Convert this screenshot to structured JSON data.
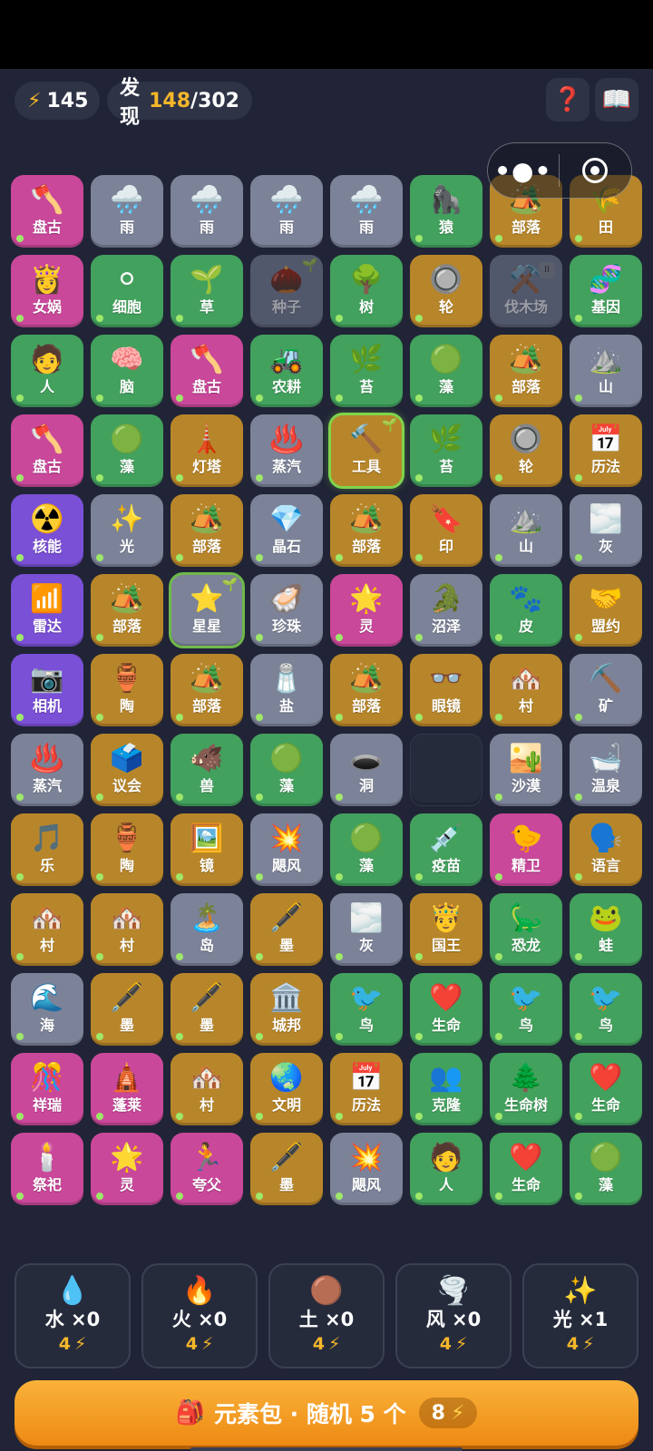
{
  "header": {
    "energy": "145",
    "discover_label": "发现",
    "discover_found": "148",
    "discover_total": "/302",
    "help_icon": "❓",
    "book_icon": "📖"
  },
  "capsule": {
    "more": "•●•"
  },
  "tiles": [
    {
      "e": "🪓",
      "l": "盘古",
      "c": "pink",
      "dot": true
    },
    {
      "e": "🌧️",
      "l": "雨",
      "c": "gray"
    },
    {
      "e": "🌧️",
      "l": "雨",
      "c": "gray"
    },
    {
      "e": "🌧️",
      "l": "雨",
      "c": "gray"
    },
    {
      "e": "🌧️",
      "l": "雨",
      "c": "gray"
    },
    {
      "e": "🦍",
      "l": "猿",
      "c": "green",
      "dot": true
    },
    {
      "e": "🏕️",
      "l": "部落",
      "c": "gold",
      "dot": true
    },
    {
      "e": "🌾",
      "l": "田",
      "c": "gold",
      "dot": true
    },
    {
      "e": "👸",
      "l": "女娲",
      "c": "pink",
      "dot": true
    },
    {
      "e": "⚪",
      "l": "细胞",
      "c": "green",
      "dot": true
    },
    {
      "e": "🌱",
      "l": "草",
      "c": "green",
      "dot": true
    },
    {
      "e": "🌰",
      "l": "种子",
      "c": "gray",
      "fade": true,
      "sprout": true
    },
    {
      "e": "🌳",
      "l": "树",
      "c": "green",
      "dot": true
    },
    {
      "e": "🔘",
      "l": "轮",
      "c": "gold",
      "dot": true
    },
    {
      "e": "⚒️",
      "l": "伐木场",
      "c": "gray",
      "fade": true,
      "pause": true
    },
    {
      "e": "🧬",
      "l": "基因",
      "c": "green",
      "dot": true
    },
    {
      "e": "🧑",
      "l": "人",
      "c": "green",
      "dot": true
    },
    {
      "e": "🧠",
      "l": "脑",
      "c": "green",
      "dot": true
    },
    {
      "e": "🪓",
      "l": "盘古",
      "c": "pink",
      "dot": true
    },
    {
      "e": "🚜",
      "l": "农耕",
      "c": "green",
      "dot": true
    },
    {
      "e": "🌿",
      "l": "苔",
      "c": "green",
      "dot": true
    },
    {
      "e": "🟢",
      "l": "藻",
      "c": "green",
      "dot": true
    },
    {
      "e": "🏕️",
      "l": "部落",
      "c": "gold",
      "dot": true
    },
    {
      "e": "⛰️",
      "l": "山",
      "c": "gray",
      "dot": true
    },
    {
      "e": "🪓",
      "l": "盘古",
      "c": "pink",
      "dot": true
    },
    {
      "e": "🟢",
      "l": "藻",
      "c": "green",
      "dot": true
    },
    {
      "e": "🗼",
      "l": "灯塔",
      "c": "gold",
      "dot": true
    },
    {
      "e": "♨️",
      "l": "蒸汽",
      "c": "gray",
      "dot": true
    },
    {
      "e": "🔨",
      "l": "工具",
      "c": "gold",
      "hl": true,
      "sprout": true
    },
    {
      "e": "🌿",
      "l": "苔",
      "c": "green",
      "dot": true
    },
    {
      "e": "🔘",
      "l": "轮",
      "c": "gold",
      "dot": true
    },
    {
      "e": "📅",
      "l": "历法",
      "c": "gold",
      "dot": true
    },
    {
      "e": "☢️",
      "l": "核能",
      "c": "purple",
      "dot": true
    },
    {
      "e": "✨",
      "l": "光",
      "c": "gray",
      "dot": true
    },
    {
      "e": "🏕️",
      "l": "部落",
      "c": "gold",
      "dot": true
    },
    {
      "e": "💎",
      "l": "晶石",
      "c": "gray",
      "dot": true
    },
    {
      "e": "🏕️",
      "l": "部落",
      "c": "gold",
      "dot": true
    },
    {
      "e": "🔖",
      "l": "印",
      "c": "gold",
      "dot": true
    },
    {
      "e": "⛰️",
      "l": "山",
      "c": "gray",
      "dot": true
    },
    {
      "e": "🌫️",
      "l": "灰",
      "c": "gray",
      "dot": true
    },
    {
      "e": "📶",
      "l": "雷达",
      "c": "purple",
      "dot": true
    },
    {
      "e": "🏕️",
      "l": "部落",
      "c": "gold",
      "dot": true
    },
    {
      "e": "⭐",
      "l": "星星",
      "c": "gray",
      "hl2": true,
      "sprout": true
    },
    {
      "e": "🦪",
      "l": "珍珠",
      "c": "gray",
      "dot": true
    },
    {
      "e": "🌟",
      "l": "灵",
      "c": "pink",
      "dot": true
    },
    {
      "e": "🐊",
      "l": "沼泽",
      "c": "gray",
      "dot": true
    },
    {
      "e": "🐾",
      "l": "皮",
      "c": "green",
      "dot": true
    },
    {
      "e": "🤝",
      "l": "盟约",
      "c": "gold",
      "dot": true
    },
    {
      "e": "📷",
      "l": "相机",
      "c": "purple",
      "dot": true
    },
    {
      "e": "🏺",
      "l": "陶",
      "c": "gold",
      "dot": true
    },
    {
      "e": "🏕️",
      "l": "部落",
      "c": "gold",
      "dot": true
    },
    {
      "e": "🧂",
      "l": "盐",
      "c": "gray",
      "dot": true
    },
    {
      "e": "🏕️",
      "l": "部落",
      "c": "gold",
      "dot": true
    },
    {
      "e": "👓",
      "l": "眼镜",
      "c": "gold",
      "dot": true
    },
    {
      "e": "🏘️",
      "l": "村",
      "c": "gold",
      "dot": true
    },
    {
      "e": "⛏️",
      "l": "矿",
      "c": "gray",
      "dot": true
    },
    {
      "e": "♨️",
      "l": "蒸汽",
      "c": "gray",
      "dot": true
    },
    {
      "e": "🗳️",
      "l": "议会",
      "c": "gold",
      "dot": true
    },
    {
      "e": "🐗",
      "l": "兽",
      "c": "green",
      "dot": true
    },
    {
      "e": "🟢",
      "l": "藻",
      "c": "green",
      "dot": true
    },
    {
      "e": "🕳️",
      "l": "洞",
      "c": "gray",
      "dot": true
    },
    {
      "e": "",
      "l": "",
      "c": "empty"
    },
    {
      "e": "🏜️",
      "l": "沙漠",
      "c": "gray",
      "dot": true
    },
    {
      "e": "🛁",
      "l": "温泉",
      "c": "gray",
      "dot": true
    },
    {
      "e": "🎵",
      "l": "乐",
      "c": "gold",
      "dot": true
    },
    {
      "e": "🏺",
      "l": "陶",
      "c": "gold",
      "dot": true
    },
    {
      "e": "🖼️",
      "l": "镜",
      "c": "gold",
      "dot": true
    },
    {
      "e": "💥",
      "l": "飓风",
      "c": "gray",
      "dot": true
    },
    {
      "e": "🟢",
      "l": "藻",
      "c": "green",
      "dot": true
    },
    {
      "e": "💉",
      "l": "疫苗",
      "c": "green",
      "dot": true
    },
    {
      "e": "🐤",
      "l": "精卫",
      "c": "pink",
      "dot": true
    },
    {
      "e": "🗣️",
      "l": "语言",
      "c": "gold",
      "dot": true
    },
    {
      "e": "🏘️",
      "l": "村",
      "c": "gold",
      "dot": true
    },
    {
      "e": "🏘️",
      "l": "村",
      "c": "gold",
      "dot": true
    },
    {
      "e": "🏝️",
      "l": "岛",
      "c": "gray",
      "dot": true
    },
    {
      "e": "🖋️",
      "l": "墨",
      "c": "gold",
      "dot": true
    },
    {
      "e": "🌫️",
      "l": "灰",
      "c": "gray",
      "dot": true
    },
    {
      "e": "🤴",
      "l": "国王",
      "c": "gold",
      "dot": true
    },
    {
      "e": "🦕",
      "l": "恐龙",
      "c": "green",
      "dot": true
    },
    {
      "e": "🐸",
      "l": "蛙",
      "c": "green",
      "dot": true
    },
    {
      "e": "🌊",
      "l": "海",
      "c": "gray",
      "dot": true
    },
    {
      "e": "🖋️",
      "l": "墨",
      "c": "gold",
      "dot": true
    },
    {
      "e": "🖋️",
      "l": "墨",
      "c": "gold",
      "dot": true
    },
    {
      "e": "🏛️",
      "l": "城邦",
      "c": "gold",
      "dot": true
    },
    {
      "e": "🐦",
      "l": "鸟",
      "c": "green",
      "dot": true
    },
    {
      "e": "❤️",
      "l": "生命",
      "c": "green",
      "dot": true
    },
    {
      "e": "🐦",
      "l": "鸟",
      "c": "green",
      "dot": true
    },
    {
      "e": "🐦",
      "l": "鸟",
      "c": "green",
      "dot": true
    },
    {
      "e": "🎊",
      "l": "祥瑞",
      "c": "pink",
      "dot": true
    },
    {
      "e": "🛕",
      "l": "蓬莱",
      "c": "pink",
      "dot": true
    },
    {
      "e": "🏘️",
      "l": "村",
      "c": "gold",
      "dot": true
    },
    {
      "e": "🌏",
      "l": "文明",
      "c": "gold",
      "dot": true
    },
    {
      "e": "📅",
      "l": "历法",
      "c": "gold",
      "dot": true
    },
    {
      "e": "👥",
      "l": "克隆",
      "c": "green",
      "dot": true
    },
    {
      "e": "🌲",
      "l": "生命树",
      "c": "green",
      "dot": true
    },
    {
      "e": "❤️",
      "l": "生命",
      "c": "green",
      "dot": true
    },
    {
      "e": "🕯️",
      "l": "祭祀",
      "c": "pink",
      "dot": true
    },
    {
      "e": "🌟",
      "l": "灵",
      "c": "pink",
      "dot": true
    },
    {
      "e": "🏃",
      "l": "夸父",
      "c": "pink",
      "dot": true
    },
    {
      "e": "🖋️",
      "l": "墨",
      "c": "gold",
      "dot": true
    },
    {
      "e": "💥",
      "l": "飓风",
      "c": "gray",
      "dot": true
    },
    {
      "e": "🧑",
      "l": "人",
      "c": "green",
      "dot": true
    },
    {
      "e": "❤️",
      "l": "生命",
      "c": "green",
      "dot": true
    },
    {
      "e": "🟢",
      "l": "藻",
      "c": "green",
      "dot": true
    }
  ],
  "elements": [
    {
      "emoji": "💧",
      "name": "水 ×0",
      "cost": "4"
    },
    {
      "emoji": "🔥",
      "name": "火 ×0",
      "cost": "4"
    },
    {
      "emoji": "🟤",
      "name": "土 ×0",
      "cost": "4"
    },
    {
      "emoji": "🌪️",
      "name": "风 ×0",
      "cost": "4"
    },
    {
      "emoji": "✨",
      "name": "光 ×1",
      "cost": "4"
    }
  ],
  "pack": {
    "icon": "🎒",
    "label": "元素包 · 随机 5 个",
    "cost": "8"
  }
}
